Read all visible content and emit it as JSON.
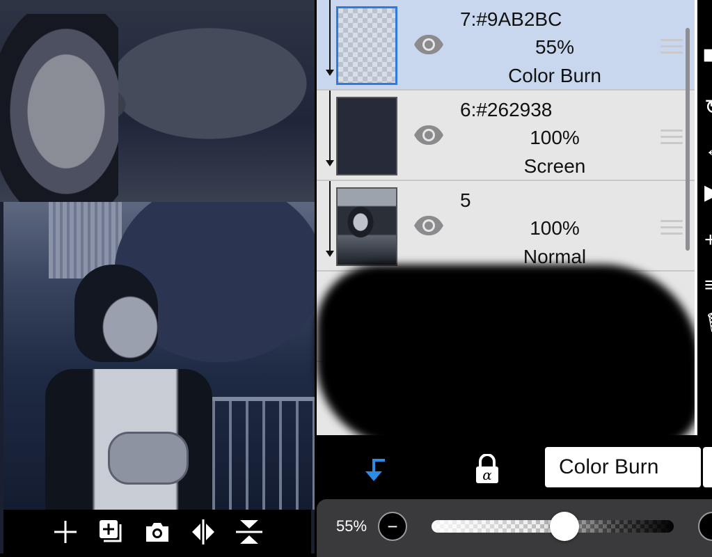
{
  "layers": [
    {
      "name": "7:#9AB2BC",
      "opacity": "55%",
      "blend": "Color Burn",
      "selected": true
    },
    {
      "name": "6:#262938",
      "opacity": "100%",
      "blend": "Screen",
      "selected": false
    },
    {
      "name": "5",
      "opacity": "100%",
      "blend": "Normal",
      "selected": false
    }
  ],
  "layer_tools": {
    "blend_mode": "Color Burn"
  },
  "opacity_control": {
    "label": "55%",
    "value": 0.55,
    "decrease": "−"
  },
  "colors": {
    "selected_row": "#c9d7ee",
    "accent": "#2d7be0",
    "layer6_color": "#262938",
    "layer7_color": "#9AB2BC"
  },
  "canvas_tools": [
    "add-layer-icon",
    "add-copy-icon",
    "camera-icon",
    "flip-horizontal-icon",
    "flip-vertical-icon"
  ]
}
